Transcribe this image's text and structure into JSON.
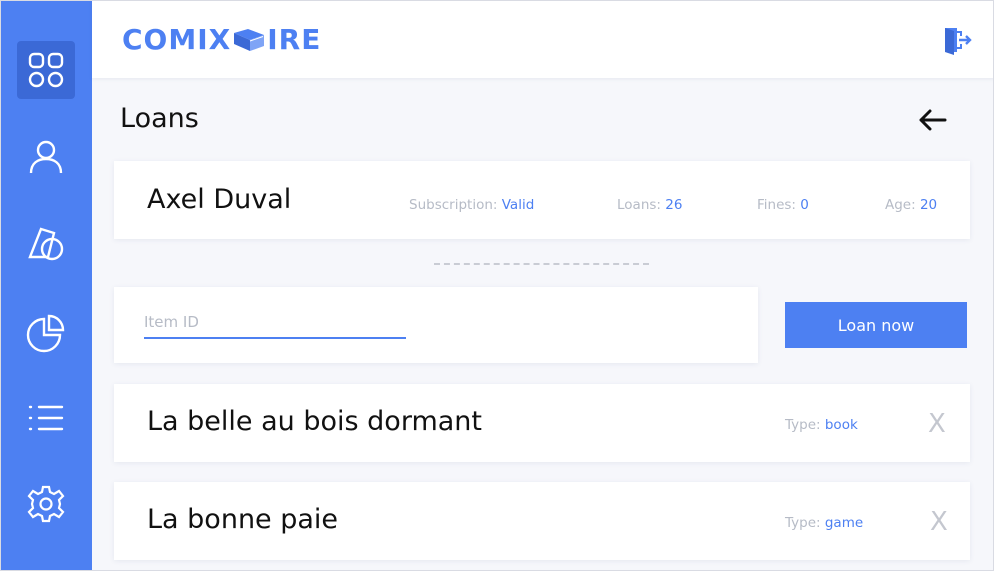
{
  "app": {
    "logo": {
      "left_text": "COMIX",
      "right_text": "IRE"
    },
    "colors": {
      "accent": "#4d80f2",
      "accent_dark": "#3b69d6",
      "muted": "#b6bbc6",
      "background": "#f6f7fb"
    }
  },
  "sidebar": {
    "items": [
      {
        "icon": "dashboard-icon",
        "active": true
      },
      {
        "icon": "user-icon",
        "active": false
      },
      {
        "icon": "shapes-icon",
        "active": false
      },
      {
        "icon": "pie-chart-icon",
        "active": false
      },
      {
        "icon": "list-icon",
        "active": false
      },
      {
        "icon": "gear-icon",
        "active": false
      }
    ]
  },
  "header": {
    "logout_icon": "logout-icon"
  },
  "page": {
    "title": "Loans",
    "back_icon": "arrow-left-icon"
  },
  "user": {
    "name": "Axel Duval",
    "subscription_label": "Subscription:",
    "subscription_value": "Valid",
    "loans_label": "Loans:",
    "loans_value": "26",
    "fines_label": "Fines:",
    "fines_value": "0",
    "age_label": "Age:",
    "age_value": "20"
  },
  "loan_form": {
    "item_placeholder": "Item ID",
    "item_value": "",
    "button_label": "Loan now"
  },
  "items": [
    {
      "title": "La belle au bois dormant",
      "type_label": "Type:",
      "type_value": "book",
      "remove_label": "X"
    },
    {
      "title": "La bonne paie",
      "type_label": "Type:",
      "type_value": "game",
      "remove_label": "X"
    }
  ]
}
